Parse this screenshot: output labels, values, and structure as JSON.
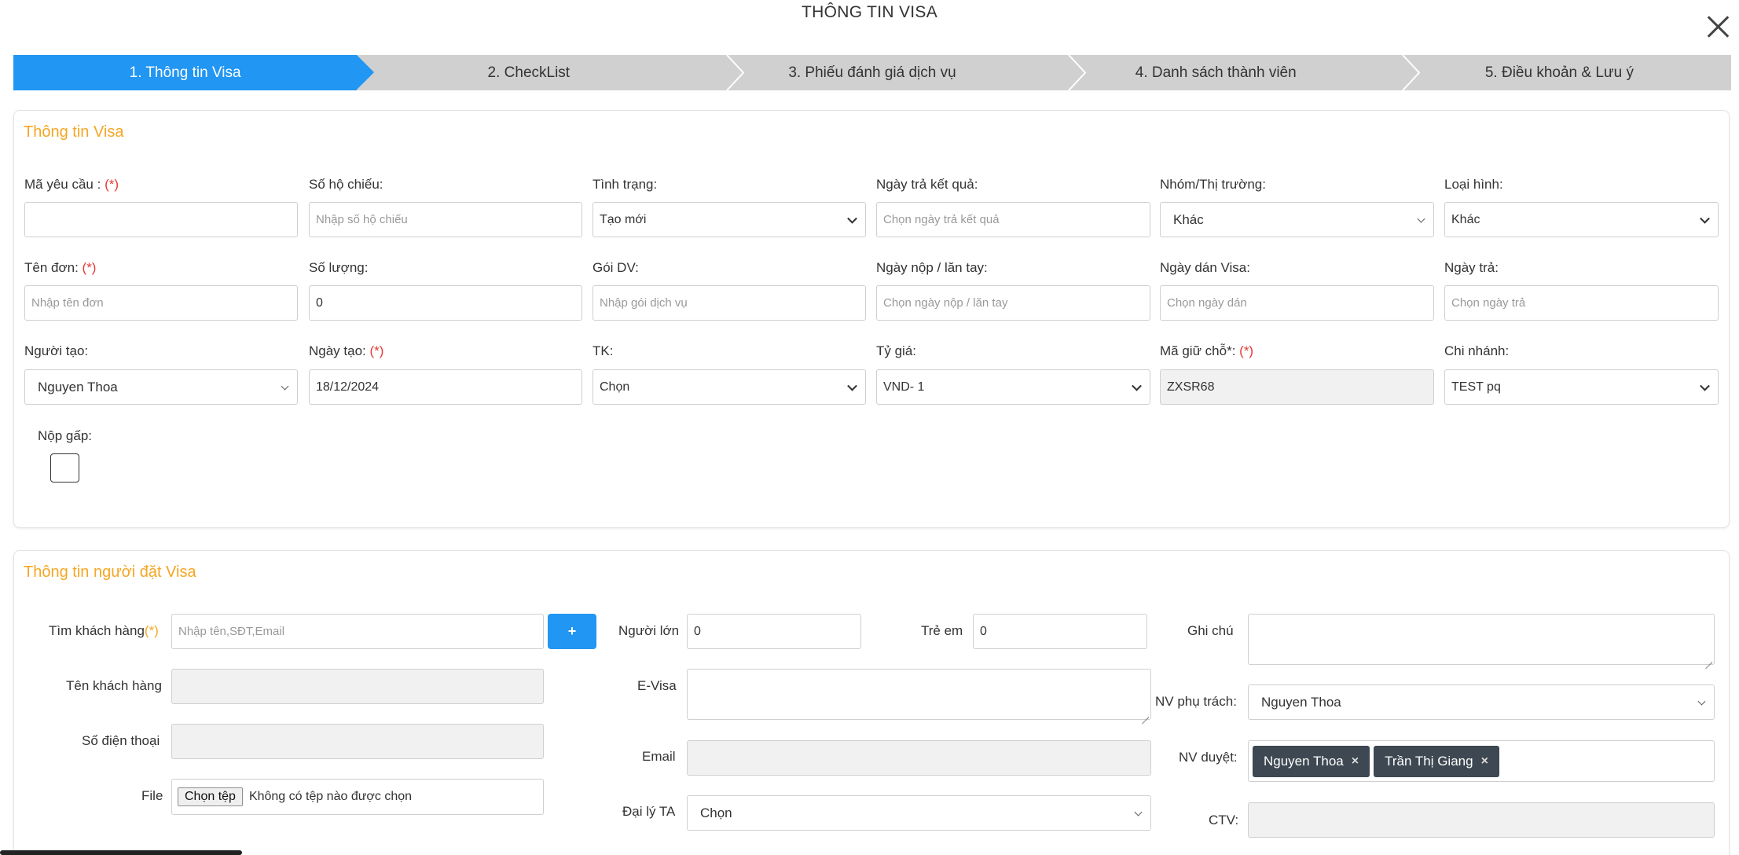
{
  "modal": {
    "title": "THÔNG TIN VISA"
  },
  "steps": [
    {
      "label": "1. Thông tin Visa",
      "active": true
    },
    {
      "label": "2. CheckList"
    },
    {
      "label": "3. Phiếu đánh giá dịch vụ"
    },
    {
      "label": "4. Danh sách thành viên"
    },
    {
      "label": "5. Điều khoản & Lưu ý"
    }
  ],
  "visa": {
    "section_title": "Thông tin Visa",
    "required_mark": "(*)",
    "ma_yeu_cau": {
      "label": "Mã yêu cầu :",
      "value": ""
    },
    "so_ho_chieu": {
      "label": "Số hộ chiếu:",
      "placeholder": "Nhập số hộ chiếu"
    },
    "tinh_trang": {
      "label": "Tình trạng:",
      "value": "Tạo mới"
    },
    "ngay_tra_ket_qua": {
      "label": "Ngày trả kết quả:",
      "placeholder": "Chọn ngày trả kết quả"
    },
    "nhom_thi_truong": {
      "label": "Nhóm/Thị trường:",
      "value": "Khác"
    },
    "loai_hinh": {
      "label": "Loại hình:",
      "value": "Khác"
    },
    "ten_don": {
      "label": "Tên đơn:",
      "placeholder": "Nhập tên đơn"
    },
    "so_luong": {
      "label": "Số lượng:",
      "value": "0"
    },
    "goi_dv": {
      "label": "Gói DV:",
      "placeholder": "Nhập gói dịch vụ"
    },
    "ngay_nop": {
      "label": "Ngày nộp / lăn tay:",
      "placeholder": "Chọn ngày nộp / lăn tay"
    },
    "ngay_dan_visa": {
      "label": "Ngày dán Visa:",
      "placeholder": "Chọn ngày dán"
    },
    "ngay_tra": {
      "label": "Ngày trả:",
      "placeholder": "Chọn ngày trả"
    },
    "nguoi_tao": {
      "label": "Người tạo:",
      "value": "Nguyen Thoa"
    },
    "ngay_tao": {
      "label": "Ngày tạo:",
      "value": "18/12/2024"
    },
    "tk": {
      "label": "TK:",
      "value": "Chọn"
    },
    "ty_gia": {
      "label": "Tỷ giá:",
      "value": "VND- 1"
    },
    "ma_giu_cho": {
      "label": "Mã giữ chỗ*:",
      "value": "ZXSR68"
    },
    "chi_nhanh": {
      "label": "Chi nhánh:",
      "value": "TEST pq"
    },
    "nop_gap": {
      "label": "Nộp gấp:"
    }
  },
  "booker": {
    "section_title": "Thông tin người đặt Visa",
    "tim_khach_hang": {
      "label": "Tìm khách hàng",
      "req": "(*)",
      "placeholder": "Nhập tên,SĐT,Email"
    },
    "plus": "+",
    "ten_khach_hang": {
      "label": "Tên khách hàng"
    },
    "so_dien_thoai": {
      "label": "Số điện thoại"
    },
    "file": {
      "label": "File",
      "button": "Chọn tệp",
      "status": "Không có tệp nào được chọn"
    },
    "nguoi_lon": {
      "label": "Người lớn",
      "value": "0"
    },
    "tre_em": {
      "label": "Trẻ em",
      "value": "0"
    },
    "e_visa": {
      "label": "E-Visa"
    },
    "email": {
      "label": "Email"
    },
    "dai_ly_ta": {
      "label": "Đại lý TA",
      "value": "Chọn"
    },
    "ghi_chu": {
      "label": "Ghi chú"
    },
    "nv_phu_trach": {
      "label": "NV phụ trách:",
      "value": "Nguyen Thoa"
    },
    "nv_duyet": {
      "label": "NV duyệt:",
      "tags": [
        "Nguyen Thoa",
        "Trần Thị Giang"
      ],
      "remove": "×"
    },
    "ctv": {
      "label": "CTV:"
    }
  }
}
